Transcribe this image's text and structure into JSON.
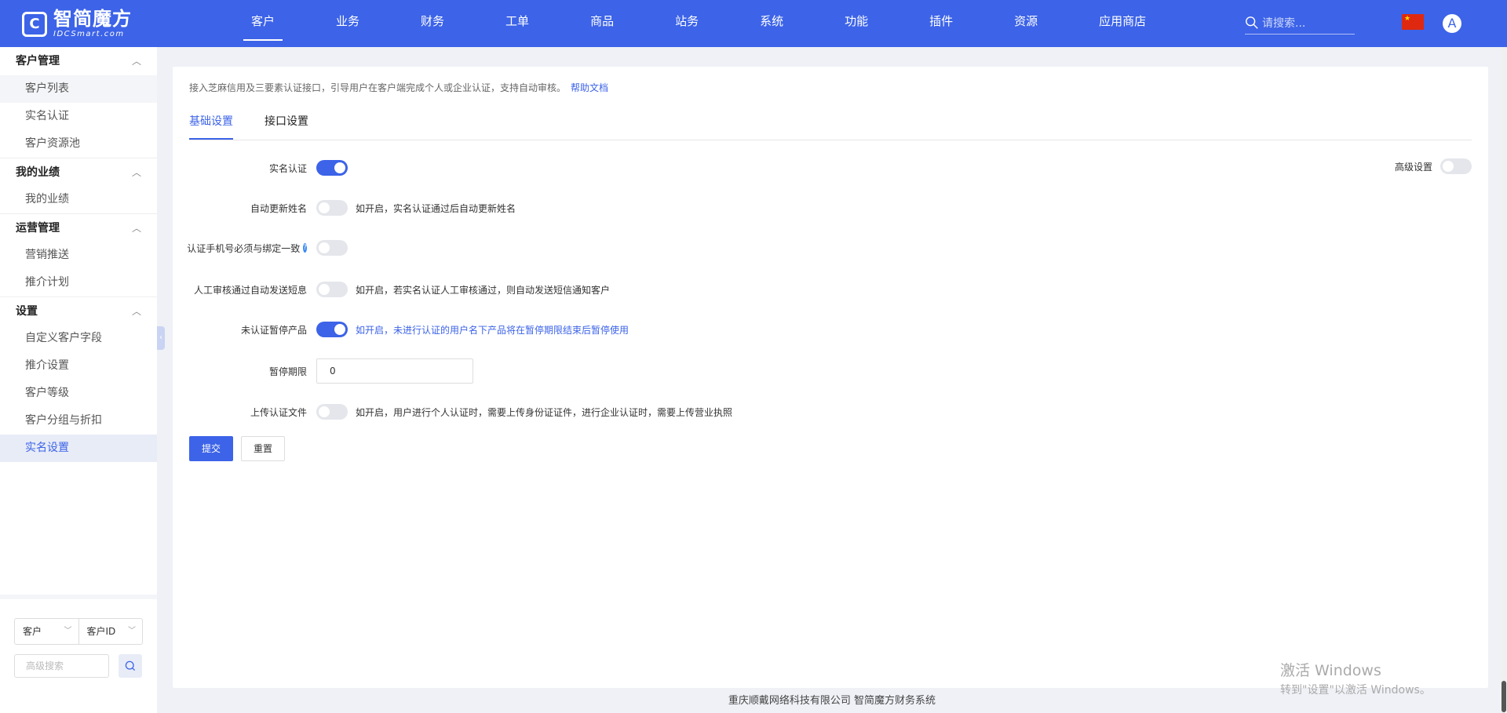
{
  "logo": {
    "mark": "C",
    "cn": "智简魔方",
    "en": "IDCSmart.com"
  },
  "nav": [
    {
      "label": "客户",
      "active": true
    },
    {
      "label": "业务"
    },
    {
      "label": "财务"
    },
    {
      "label": "工单"
    },
    {
      "label": "商品"
    },
    {
      "label": "站务"
    },
    {
      "label": "系统"
    },
    {
      "label": "功能"
    },
    {
      "label": "插件"
    },
    {
      "label": "资源"
    },
    {
      "label": "应用商店"
    }
  ],
  "search": {
    "placeholder": "请搜索..."
  },
  "avatar": "A",
  "sidebar": {
    "groups": [
      {
        "title": "客户管理",
        "items": [
          "客户列表",
          "实名认证",
          "客户资源池"
        ]
      },
      {
        "title": "我的业绩",
        "items": [
          "我的业绩"
        ]
      },
      {
        "title": "运营管理",
        "items": [
          "营销推送",
          "推介计划"
        ]
      },
      {
        "title": "设置",
        "items": [
          "自定义客户字段",
          "推介设置",
          "客户等级",
          "客户分组与折扣",
          "实名设置"
        ]
      }
    ],
    "select_left": "客户",
    "select_right": "客户ID",
    "adv_search_placeholder": "高级搜索"
  },
  "main": {
    "intro": "接入芝麻信用及三要素认证接口，引导用户在客户端完成个人或企业认证，支持自动审核。",
    "help_link": "帮助文档",
    "tabs": [
      "基础设置",
      "接口设置"
    ],
    "advanced_label": "高级设置",
    "rows": {
      "real_name": {
        "label": "实名认证"
      },
      "auto_update": {
        "label": "自动更新姓名",
        "hint": "如开启，实名认证通过后自动更新姓名"
      },
      "phone_match": {
        "label": "认证手机号必须与绑定一致",
        "help": "?"
      },
      "sms": {
        "label": "人工审核通过自动发送短息",
        "hint": "如开启，若实名认证人工审核通过，则自动发送短信通知客户"
      },
      "suspend": {
        "label": "未认证暂停产品",
        "hint": "如开启，未进行认证的用户名下产品将在暂停期限结束后暂停使用"
      },
      "period": {
        "label": "暂停期限",
        "value": "0"
      },
      "upload": {
        "label": "上传认证文件",
        "hint": "如开启，用户进行个人认证时，需要上传身份证证件，进行企业认证时，需要上传营业执照"
      }
    },
    "submit": "提交",
    "reset": "重置"
  },
  "footer": "重庆顺戴网络科技有限公司 智简魔方财务系统",
  "watermark": {
    "line1": "激活 Windows",
    "line2": "转到\"设置\"以激活 Windows。"
  },
  "colors": {
    "primary": "#3c63e8"
  }
}
